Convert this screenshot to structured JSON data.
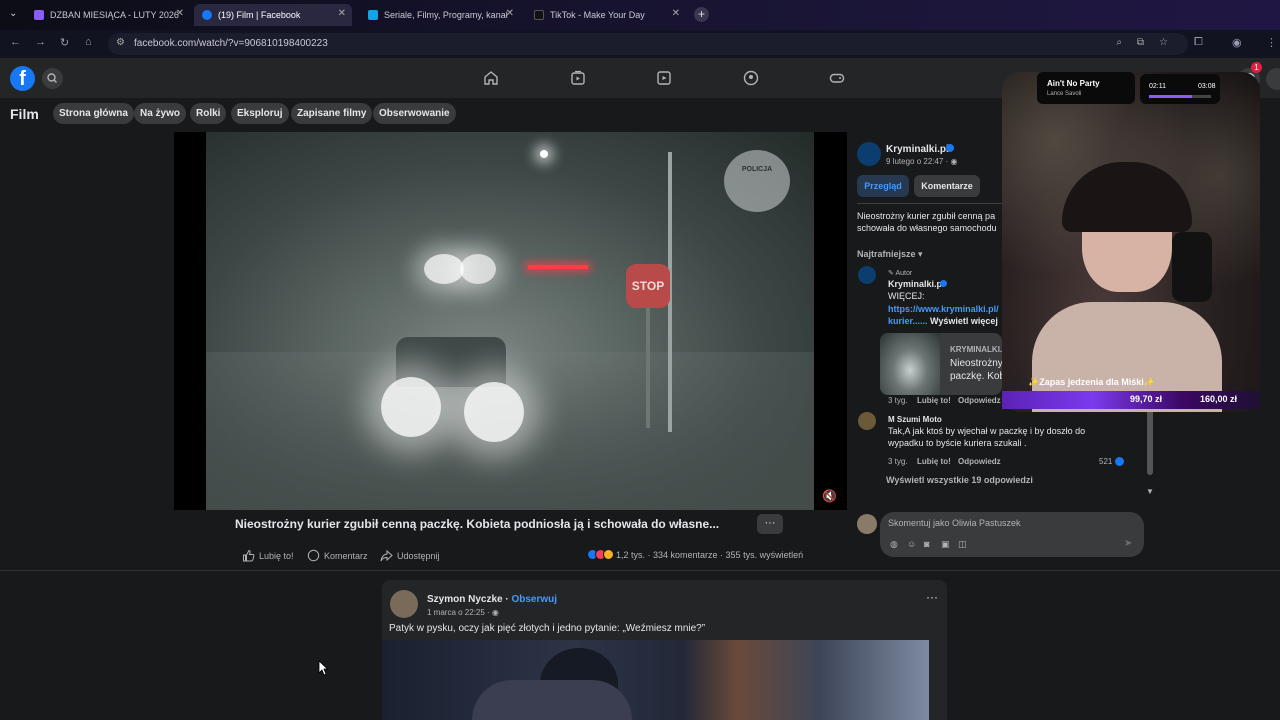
{
  "browser": {
    "tabs": [
      {
        "title": "DZBAN MIESIĄCA - LUTY 2026",
        "favicon_color": "#8b5cf6"
      },
      {
        "title": "(19) Film | Facebook",
        "favicon_color": "#1877f2"
      },
      {
        "title": "Seriale, Filmy, Programy, kanał",
        "favicon_color": "#0ea5e9"
      },
      {
        "title": "TikTok - Make Your Day",
        "favicon_color": "#111111"
      }
    ],
    "url": "facebook.com/watch/?v=906810198400223"
  },
  "fb": {
    "logo": "f",
    "notification_count": "1",
    "film_title": "Film",
    "menu": [
      "Strona główna",
      "Na żywo",
      "Rolki",
      "Eksploruj",
      "Zapisane filmy",
      "Obserwowanie"
    ]
  },
  "video": {
    "stop_sign": "STOP",
    "police_badge": "POLICJA",
    "title": "Nieostrożny kurier zgubił cenną paczkę. Kobieta podniosła ją i schowała do własne...",
    "more": "···",
    "actions": {
      "like": "Lubię to!",
      "comment": "Komentarz",
      "share": "Udostępnij"
    },
    "stats": "1,2 tys. · 334 komentarze · 355 tys. wyświetleń"
  },
  "panel": {
    "page_name": "Kryminalki.pl",
    "date": "9 lutego o 22:47 · ",
    "tab_overview": "Przegląd",
    "tab_comments": "Komentarze",
    "desc_line1": "Nieostrożny kurier zgubił cenną pa",
    "desc_line2": "schowała do własnego samochodu",
    "sort": "Najtrafniejsze",
    "c1": {
      "badge": "Autor",
      "name": "Kryminalki.pl",
      "line1": "WIĘCEJ:",
      "link1": "https://www.kryminalki.pl/",
      "link2": "kurier......",
      "more": "Wyświetl więcej",
      "card_source": "KRYMINALKI.",
      "card_line1": "Nieostrożny",
      "card_line2": "paczkę. Kobi",
      "time": "3 tyg.",
      "like": "Lubię to!",
      "reply": "Odpowiedz"
    },
    "c2": {
      "name": "M Szumi Moto",
      "line1": "Tak,A jak ktoś by wjechał w paczkę i by doszło do",
      "line2": "wypadku to byście kuriera szukali .",
      "time": "3 tyg.",
      "like": "Lubię to!",
      "reply": "Odpowiedz",
      "likes": "521"
    },
    "view_replies": "Wyświetl wszystkie 19 odpowiedzi",
    "comment_placeholder": "Skomentuj jako Oliwia Pastuszek"
  },
  "post": {
    "author": "Szymon Nyczke",
    "follow": "Obserwuj",
    "date": "1 marca o 22:25 · ",
    "text": "Patyk w pysku, oczy jak pięć złotych i jedno pytanie: „Weźmiesz mnie?”",
    "more": "···"
  },
  "stream": {
    "song": "Ain't No Party",
    "artist": "Lance Savoli",
    "time_elapsed": "02:11",
    "time_total": "03:08",
    "goal_title": "✨Zapas jedzenia dla Miśki✨",
    "goal_current": "99,70 zł",
    "goal_target": "160,00 zł"
  }
}
